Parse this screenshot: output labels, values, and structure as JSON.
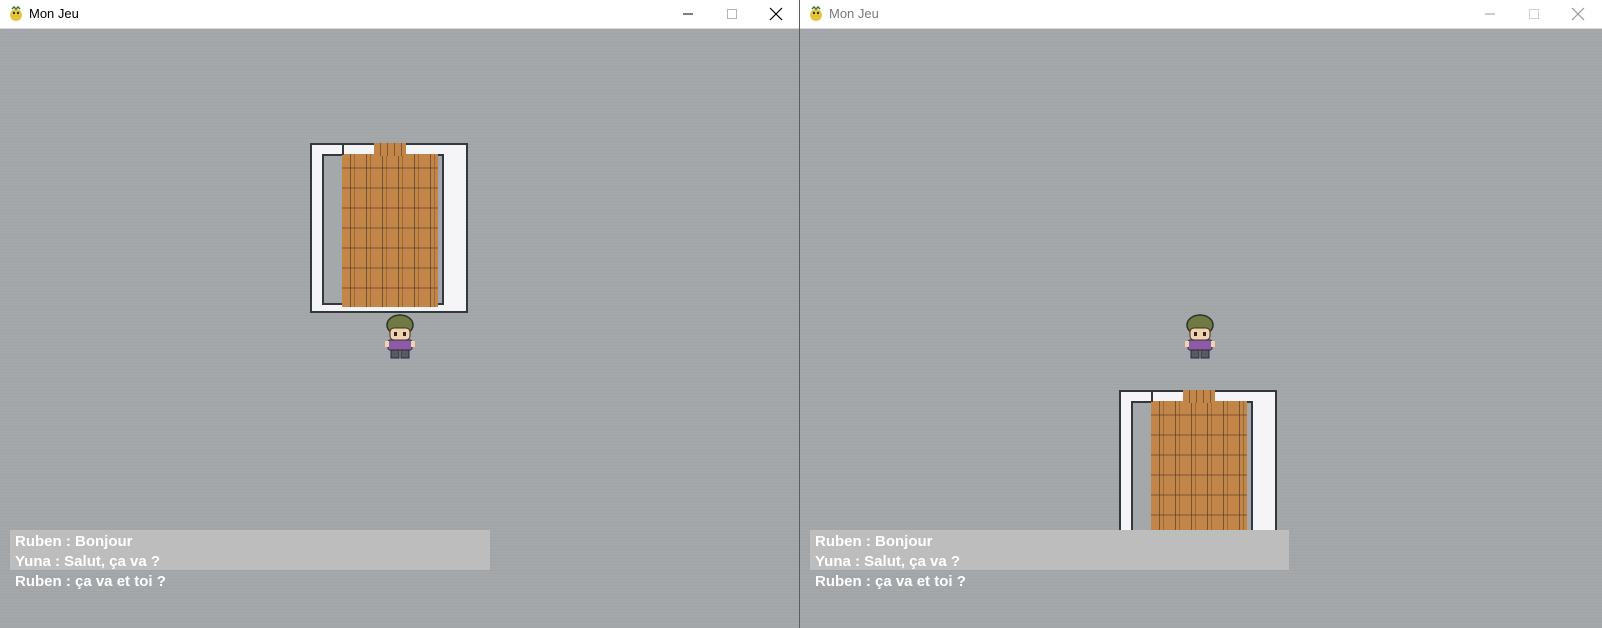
{
  "windows": [
    {
      "id": "left",
      "title": "Mon Jeu",
      "chat": [
        "Ruben : Bonjour",
        "Yuna : Salut, ça va ?",
        "Ruben : ça va et toi ?"
      ]
    },
    {
      "id": "right",
      "title": "Mon Jeu",
      "chat": [
        "Ruben : Bonjour",
        "Yuna : Salut, ça va ?",
        "Ruben : ça va et toi ?"
      ]
    }
  ],
  "icons": {
    "app": "pygame-snake-icon",
    "minimize": "minimize-icon",
    "maximize": "maximize-icon",
    "close": "close-icon"
  },
  "colors": {
    "ground": "#a4a8aa",
    "chat_box": "#bdbdbd",
    "chat_text": "#ffffff",
    "floor": "#c28648",
    "wall": "#f5f5f7"
  }
}
